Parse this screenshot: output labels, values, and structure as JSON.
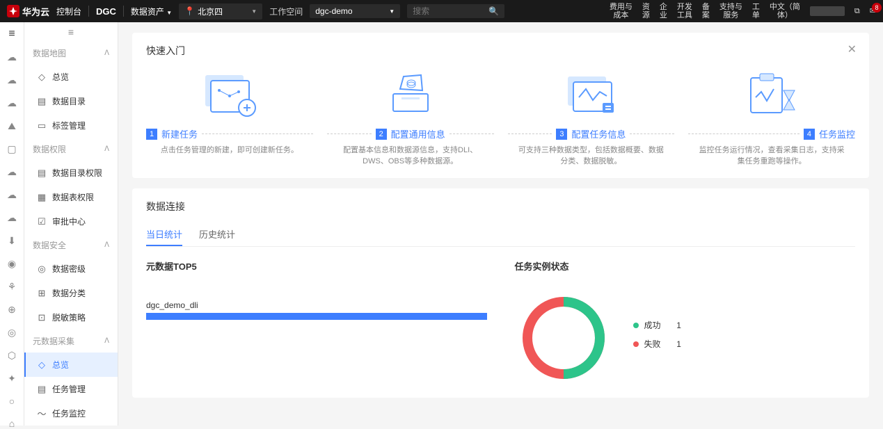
{
  "topbar": {
    "brand": "华为云",
    "console": "控制台",
    "service": "DGC",
    "asset": "数据资产",
    "region": "北京四",
    "workspace_label": "工作空间",
    "workspace_value": "dgc-demo",
    "search_placeholder": "搜索",
    "nav": [
      "费用与\n成本",
      "资\n源",
      "企\n业",
      "开发\n工具",
      "备\n案",
      "支持与\n服务",
      "工\n单",
      "中文（简\n体）"
    ],
    "badge": "8"
  },
  "sidebar": {
    "sections": [
      {
        "label": "数据地图",
        "items": [
          {
            "icon": "◇",
            "label": "总览"
          },
          {
            "icon": "▤",
            "label": "数据目录"
          },
          {
            "icon": "▭",
            "label": "标签管理"
          }
        ]
      },
      {
        "label": "数据权限",
        "items": [
          {
            "icon": "▤",
            "label": "数据目录权限"
          },
          {
            "icon": "▦",
            "label": "数据表权限"
          },
          {
            "icon": "☑",
            "label": "审批中心"
          }
        ]
      },
      {
        "label": "数据安全",
        "items": [
          {
            "icon": "◎",
            "label": "数据密级"
          },
          {
            "icon": "⊞",
            "label": "数据分类"
          },
          {
            "icon": "⊡",
            "label": "脱敏策略"
          }
        ]
      },
      {
        "label": "元数据采集",
        "items": [
          {
            "icon": "◇",
            "label": "总览",
            "active": true
          },
          {
            "icon": "▤",
            "label": "任务管理"
          },
          {
            "icon": "〜",
            "label": "任务监控"
          }
        ]
      }
    ]
  },
  "quickstart": {
    "title": "快速入门",
    "steps": [
      {
        "n": "1",
        "name": "新建任务",
        "desc": "点击任务管理的新建，即可创建新任务。"
      },
      {
        "n": "2",
        "name": "配置通用信息",
        "desc": "配置基本信息和数据源信息，支持DLI、DWS、OBS等多种数据源。"
      },
      {
        "n": "3",
        "name": "配置任务信息",
        "desc": "可支持三种数据类型，包括数据概要、数据分类、数据脱敏。"
      },
      {
        "n": "4",
        "name": "任务监控",
        "desc": "监控任务运行情况，查看采集日志，支持采集任务重跑等操作。"
      }
    ]
  },
  "conn": {
    "title": "数据连接",
    "tabs": [
      "当日统计",
      "历史统计"
    ],
    "top5_title": "元数据TOP5",
    "top5": [
      {
        "label": "dgc_demo_dli",
        "pct": 100
      }
    ],
    "status_title": "任务实例状态",
    "legend": [
      {
        "label": "成功",
        "value": "1",
        "color": "#2dc48a"
      },
      {
        "label": "失败",
        "value": "1",
        "color": "#f05656"
      }
    ]
  },
  "chart_data": [
    {
      "type": "bar",
      "title": "元数据TOP5",
      "categories": [
        "dgc_demo_dli"
      ],
      "values": [
        1
      ]
    },
    {
      "type": "pie",
      "title": "任务实例状态",
      "series": [
        {
          "name": "成功",
          "value": 1
        },
        {
          "name": "失败",
          "value": 1
        }
      ]
    }
  ]
}
